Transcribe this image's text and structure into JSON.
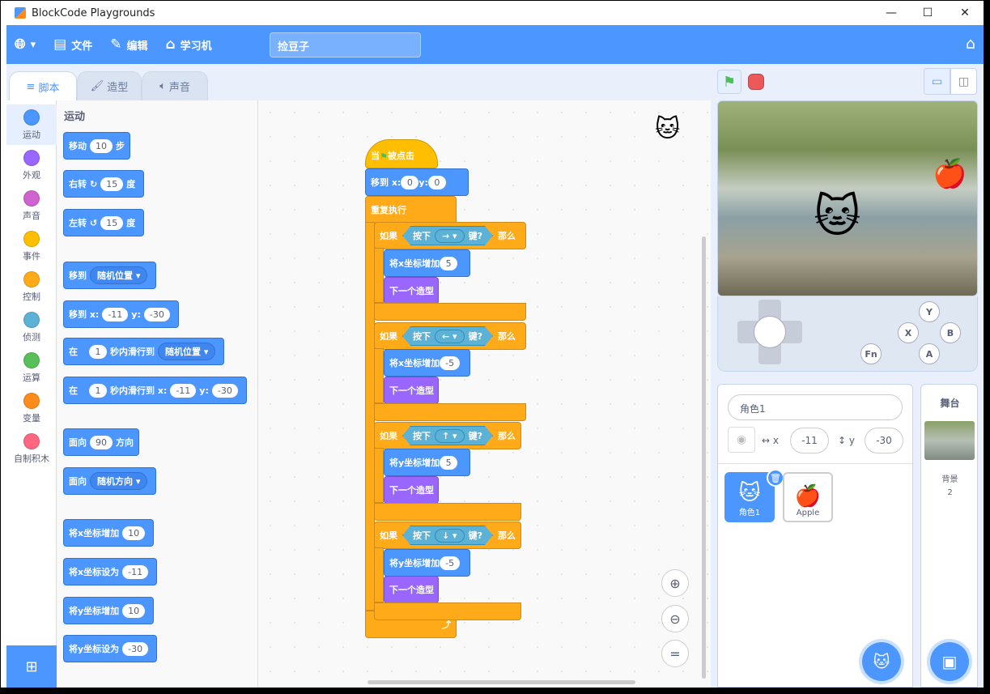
{
  "window": {
    "title": "BlockCode Playgrounds",
    "min": "—",
    "max": "☐",
    "close": "✕"
  },
  "menu": {
    "file": "文件",
    "edit": "编辑",
    "learn": "学习机",
    "project_title": "捡豆子"
  },
  "tabs": {
    "code": "脚本",
    "costumes": "造型",
    "sounds": "声音"
  },
  "categories": [
    {
      "label": "运动",
      "color": "#4c97ff"
    },
    {
      "label": "外观",
      "color": "#9966ff"
    },
    {
      "label": "声音",
      "color": "#cf63cf"
    },
    {
      "label": "事件",
      "color": "#ffbf00"
    },
    {
      "label": "控制",
      "color": "#ffab19"
    },
    {
      "label": "侦测",
      "color": "#5cb1d6"
    },
    {
      "label": "运算",
      "color": "#59c059"
    },
    {
      "label": "变量",
      "color": "#ff8c1a"
    },
    {
      "label": "自制积木",
      "color": "#ff6680"
    }
  ],
  "palette": {
    "heading": "运动",
    "move": {
      "pre": "移动",
      "val": "10",
      "post": "步"
    },
    "turn_right": {
      "pre": "右转",
      "val": "15",
      "post": "度"
    },
    "turn_left": {
      "pre": "左转",
      "val": "15",
      "post": "度"
    },
    "goto": {
      "pre": "移到",
      "dd": "随机位置 ▾"
    },
    "goto_xy": {
      "pre": "移到 x:",
      "x": "-11",
      "y_label": "y:",
      "y": "-30"
    },
    "glide": {
      "pre": "在",
      "val": "1",
      "mid": "秒内滑行到",
      "dd": "随机位置 ▾"
    },
    "glide_xy": {
      "pre": "在",
      "val": "1",
      "mid": "秒内滑行到 x:",
      "x": "-11",
      "y_label": "y:",
      "y": "-30"
    },
    "point": {
      "pre": "面向",
      "val": "90",
      "post": "方向"
    },
    "point_towards": {
      "pre": "面向",
      "dd": "随机方向 ▾"
    },
    "change_x": {
      "pre": "将x坐标增加",
      "val": "10"
    },
    "set_x": {
      "pre": "将x坐标设为",
      "val": "-11"
    },
    "change_y": {
      "pre": "将y坐标增加",
      "val": "10"
    },
    "set_y": {
      "pre": "将y坐标设为",
      "val": "-30"
    }
  },
  "script": {
    "hat": {
      "pre": "当",
      "post": "被点击"
    },
    "goto": {
      "pre": "移到 x:",
      "x": "0",
      "y_label": "y:",
      "y": "0"
    },
    "forever": "重复执行",
    "if_label": "如果",
    "then_label": "那么",
    "key_pressed": "按下",
    "key_suffix": "键?",
    "ifs": [
      {
        "key": "→ ▾",
        "action": "将x坐标增加",
        "val": "5",
        "costume": "下一个造型"
      },
      {
        "key": "← ▾",
        "action": "将x坐标增加",
        "val": "-5",
        "costume": "下一个造型"
      },
      {
        "key": "↑ ▾",
        "action": "将y坐标增加",
        "val": "5",
        "costume": "下一个造型"
      },
      {
        "key": "↓ ▾",
        "action": "将y坐标增加",
        "val": "-5",
        "costume": "下一个造型"
      }
    ]
  },
  "gamepad": {
    "y": "Y",
    "x": "X",
    "b": "B",
    "a": "A",
    "fn": "Fn"
  },
  "sprite_info": {
    "name": "角色1",
    "x_label": "x",
    "x": "-11",
    "y_label": "y",
    "y": "-30"
  },
  "sprites": [
    {
      "name": "角色1"
    },
    {
      "name": "Apple"
    }
  ],
  "stage_panel": {
    "title": "舞台",
    "backdrop_label": "背景",
    "backdrop_count": "2"
  }
}
